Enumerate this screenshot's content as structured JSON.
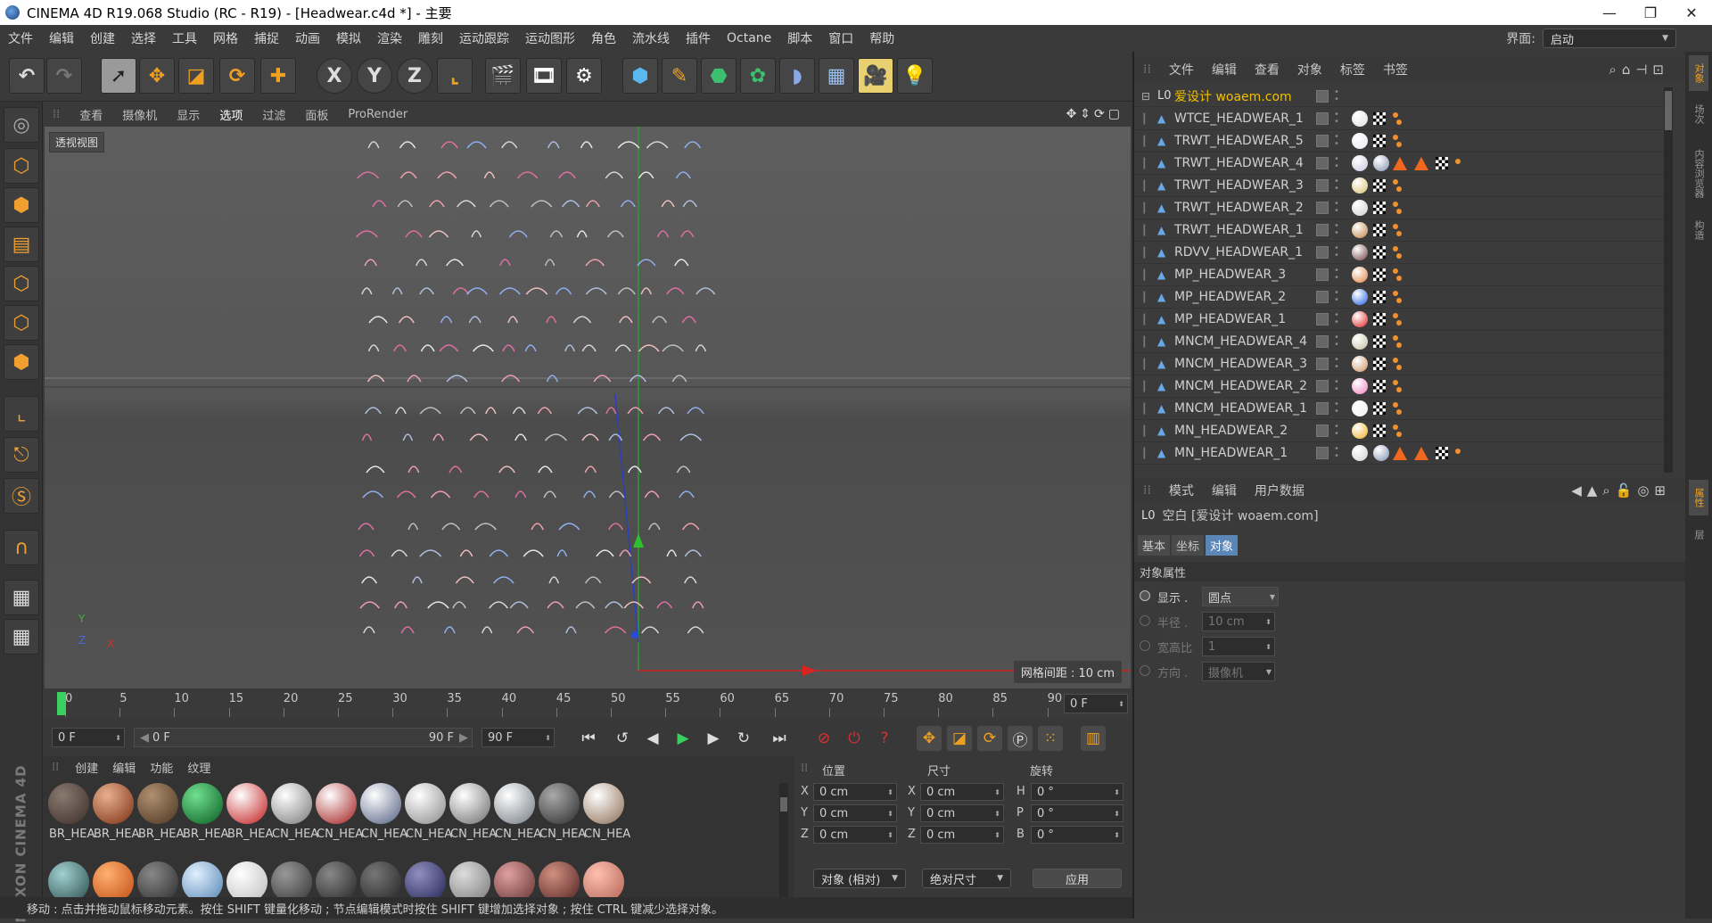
{
  "title": "CINEMA 4D R19.068 Studio (RC - R19) - [Headwear.c4d *] - 主要",
  "window_controls": {
    "minimize": "—",
    "restore": "❐",
    "close": "✕"
  },
  "menu": [
    "文件",
    "编辑",
    "创建",
    "选择",
    "工具",
    "网格",
    "捕捉",
    "动画",
    "模拟",
    "渲染",
    "雕刻",
    "运动跟踪",
    "运动图形",
    "角色",
    "流水线",
    "插件",
    "Octane",
    "脚本",
    "窗口",
    "帮助"
  ],
  "layout": {
    "label": "界面:",
    "value": "启动"
  },
  "viewport": {
    "menu": [
      "查看",
      "摄像机",
      "显示",
      "选项",
      "过滤",
      "面板",
      "ProRender"
    ],
    "label": "透视视图",
    "grid_note": "网格间距 : 10 cm"
  },
  "timeline": {
    "ticks": [
      "0",
      "5",
      "10",
      "15",
      "20",
      "25",
      "30",
      "35",
      "40",
      "45",
      "50",
      "55",
      "60",
      "65",
      "70",
      "75",
      "80",
      "85",
      "90"
    ],
    "end_field": "0 F"
  },
  "transport": {
    "current": "0 F",
    "range_start": "0 F",
    "range_end": "90 F",
    "max": "90 F"
  },
  "materials": {
    "menu": [
      "创建",
      "编辑",
      "功能",
      "纹理"
    ],
    "labels": [
      "BR_HEA",
      "BR_HEA",
      "BR_HEA",
      "BR_HEA",
      "BR_HEA",
      "CN_HEA",
      "CN_HEA",
      "CN_HEA",
      "CN_HEA",
      "CN_HEA",
      "CN_HEA",
      "CN_HEA",
      "CN_HEA"
    ]
  },
  "coords": {
    "headers": [
      "位置",
      "尺寸",
      "旋转"
    ],
    "rows": [
      {
        "axis": "X",
        "pos": "0 cm",
        "size_axis": "X",
        "size": "0 cm",
        "rot_axis": "H",
        "rot": "0 °"
      },
      {
        "axis": "Y",
        "pos": "0 cm",
        "size_axis": "Y",
        "size": "0 cm",
        "rot_axis": "P",
        "rot": "0 °"
      },
      {
        "axis": "Z",
        "pos": "0 cm",
        "size_axis": "Z",
        "size": "0 cm",
        "rot_axis": "B",
        "rot": "0 °"
      }
    ],
    "mode1": "对象 (相对)",
    "mode2": "绝对尺寸",
    "apply": "应用"
  },
  "object_manager": {
    "menu": [
      "文件",
      "编辑",
      "查看",
      "对象",
      "标签",
      "书签"
    ],
    "root": "爱设计 woaem.com",
    "objects": [
      "WTCE_HEADWEAR_1",
      "TRWT_HEADWEAR_5",
      "TRWT_HEADWEAR_4",
      "TRWT_HEADWEAR_3",
      "TRWT_HEADWEAR_2",
      "TRWT_HEADWEAR_1",
      "RDVV_HEADWEAR_1",
      "MP_HEADWEAR_3",
      "MP_HEADWEAR_2",
      "MP_HEADWEAR_1",
      "MNCM_HEADWEAR_4",
      "MNCM_HEADWEAR_3",
      "MNCM_HEADWEAR_2",
      "MNCM_HEADWEAR_1",
      "MN_HEADWEAR_2",
      "MN_HEADWEAR_1"
    ]
  },
  "attributes": {
    "menu": [
      "模式",
      "编辑",
      "用户数据"
    ],
    "header": "空白 [爱设计 woaem.com]",
    "tabs": [
      "基本",
      "坐标",
      "对象"
    ],
    "section": "对象属性",
    "props": [
      {
        "label": "显示 .",
        "value": "圆点"
      },
      {
        "label": "半径 .",
        "value": "10 cm"
      },
      {
        "label": "宽高比",
        "value": "1"
      },
      {
        "label": "方向 .",
        "value": "摄像机"
      }
    ]
  },
  "side_tabs_right": [
    "对象",
    "场次",
    "内容浏览器",
    "构造"
  ],
  "side_tabs_attr": [
    "属性",
    "层"
  ],
  "status": "移动 : 点击并拖动鼠标移动元素。按住 SHIFT 键量化移动 ; 节点编辑模式时按住 SHIFT 键增加选择对象 ; 按住 CTRL 键减少选择对象。",
  "brand": "MAXON CINEMA 4D"
}
